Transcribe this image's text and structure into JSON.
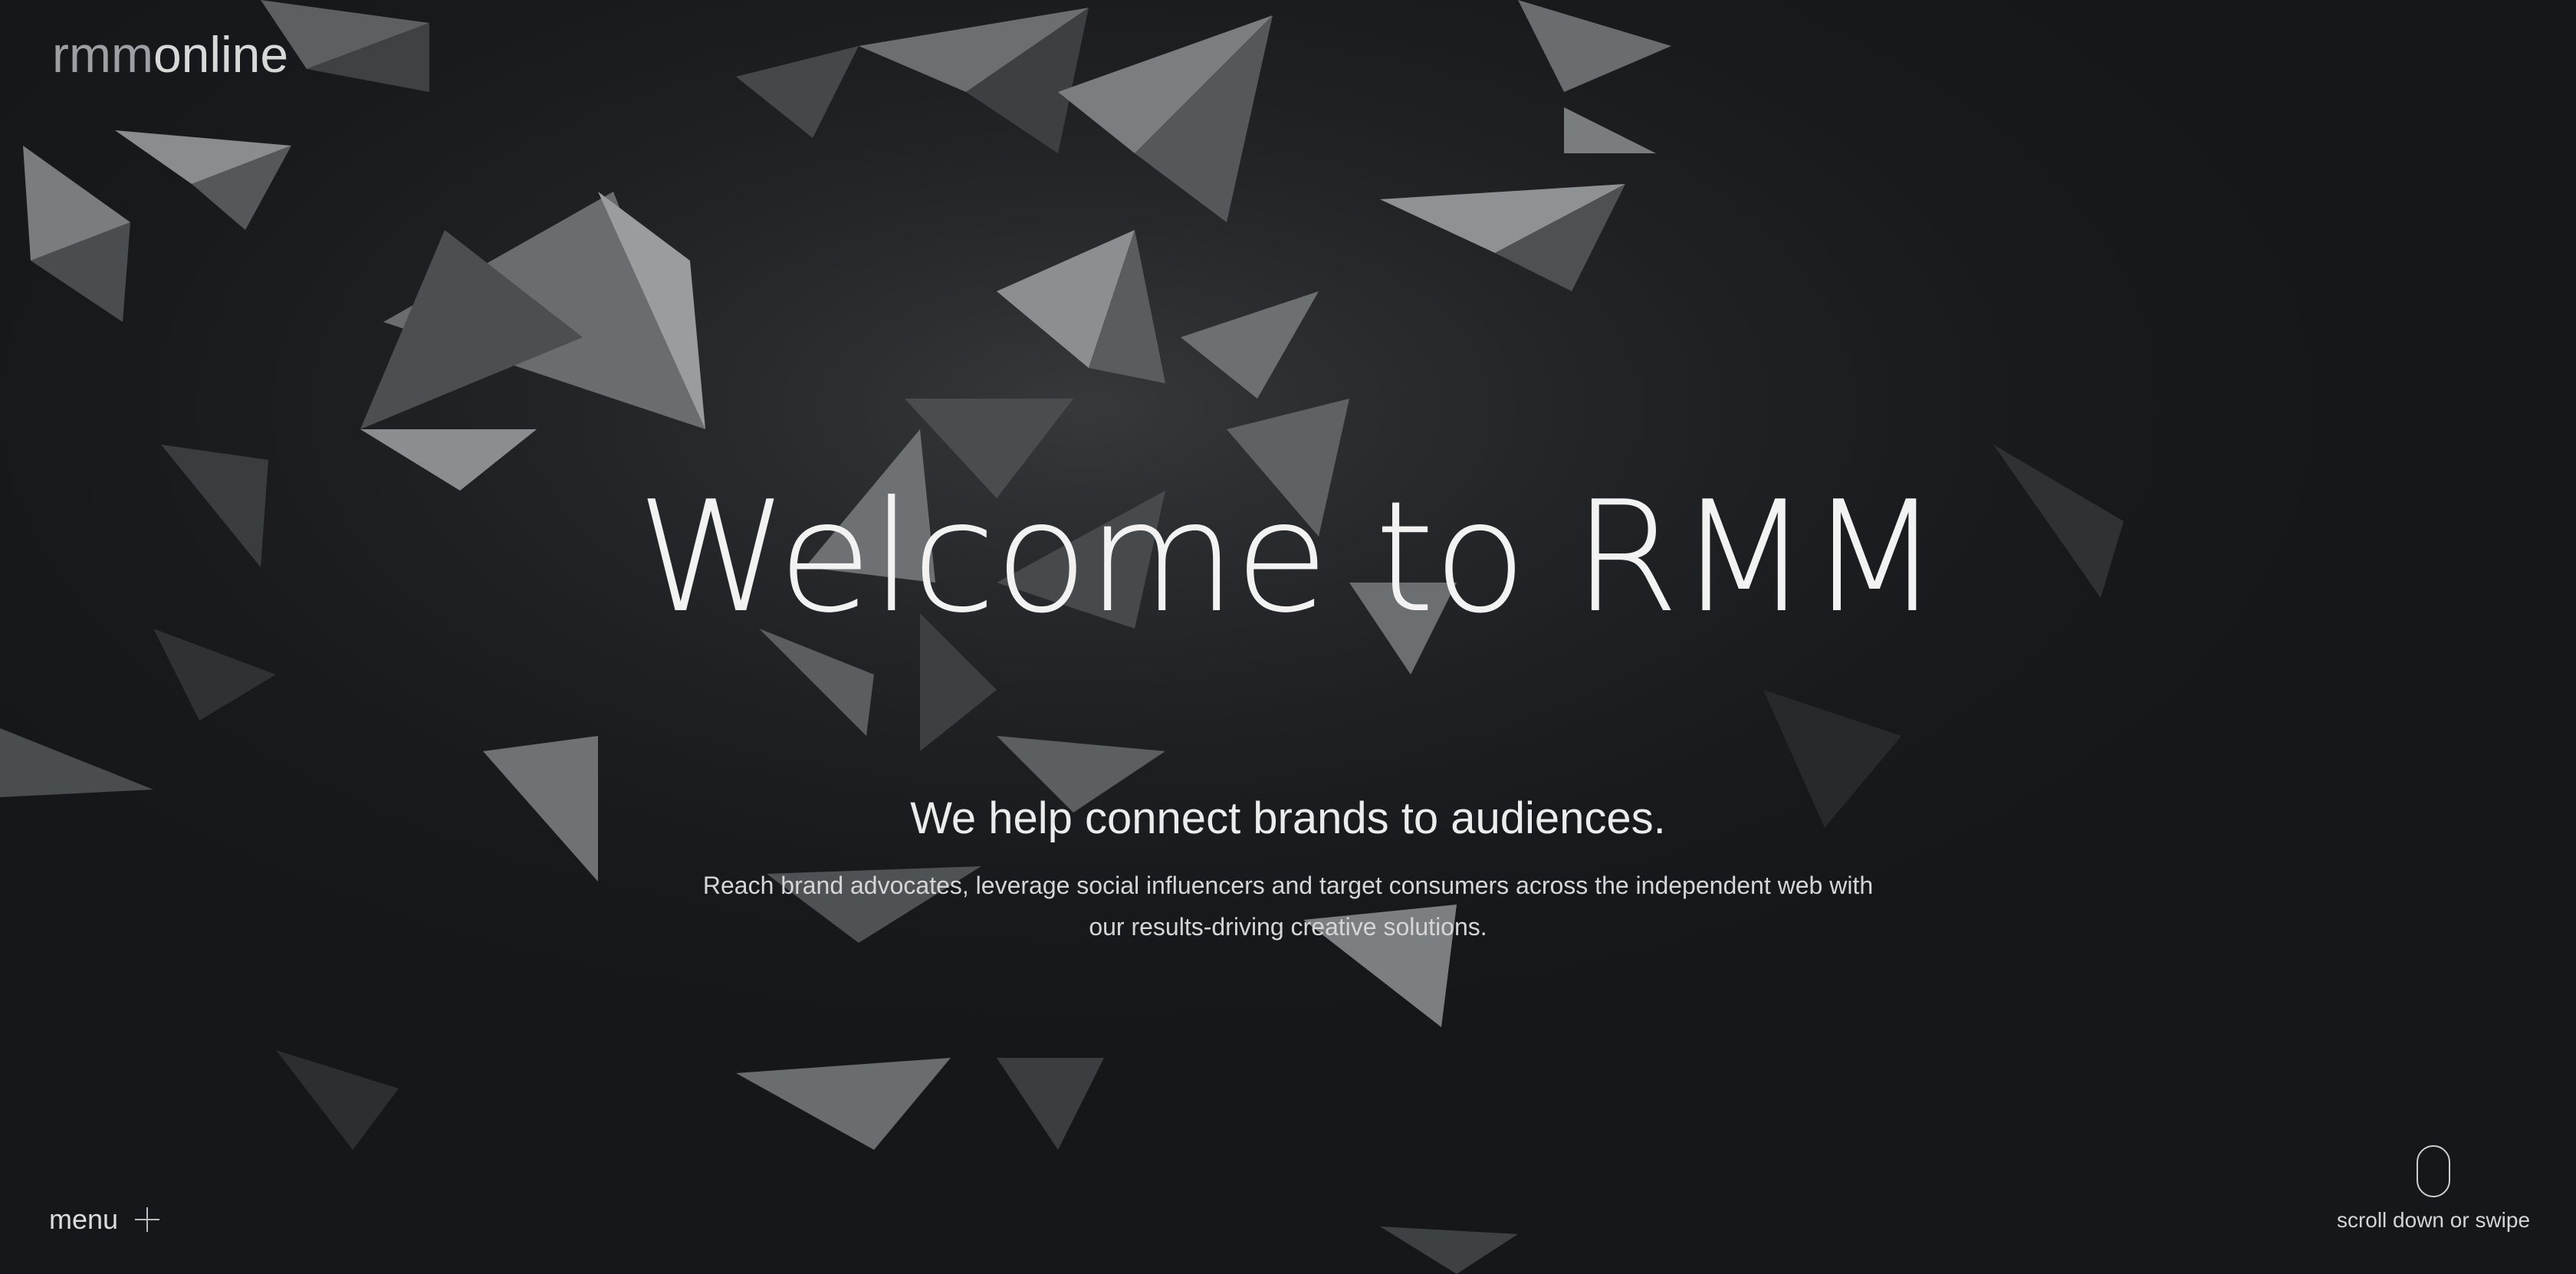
{
  "header": {
    "logo_part1": "rmm",
    "logo_part2": "online"
  },
  "hero": {
    "title": "Welcome to RMM",
    "tagline": "We help connect brands to audiences.",
    "description": "Reach brand advocates, leverage social influencers and target consumers across the independent web with our results-driving creative solutions."
  },
  "nav": {
    "menu_label": "menu",
    "menu_icon": "plus-icon"
  },
  "scroll_hint": {
    "label": "scroll down or swipe",
    "icon": "mouse-icon"
  },
  "colors": {
    "background": "#131517",
    "text": "#f2f2f2",
    "logo_muted": "#9c9fa3"
  }
}
